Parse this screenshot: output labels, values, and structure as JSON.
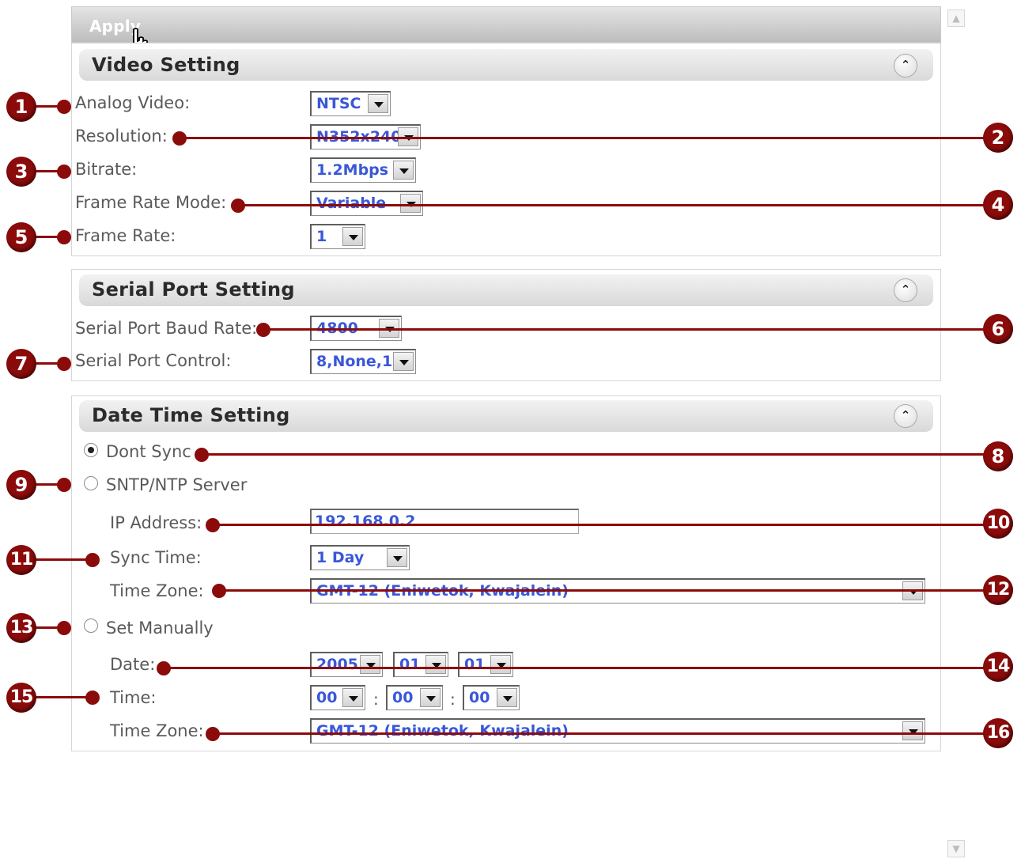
{
  "toolbar": {
    "apply_label": "Apply"
  },
  "video": {
    "title": "Video Setting",
    "analog_label": "Analog Video:",
    "analog_value": "NTSC",
    "resolution_label": "Resolution:",
    "resolution_value": "N352x240",
    "bitrate_label": "Bitrate:",
    "bitrate_value": "1.2Mbps",
    "framerate_mode_label": "Frame Rate Mode:",
    "framerate_mode_value": "Variable",
    "framerate_label": "Frame Rate:",
    "framerate_value": "1"
  },
  "serial": {
    "title": "Serial Port Setting",
    "baud_label": "Serial Port Baud Rate:",
    "baud_value": "4800",
    "control_label": "Serial Port Control:",
    "control_value": "8,None,1"
  },
  "datetime": {
    "title": "Date Time Setting",
    "dont_sync_label": "Dont Sync",
    "sntp_label": "SNTP/NTP Server",
    "ip_label": "IP Address:",
    "ip_value": "192.168.0.2",
    "sync_time_label": "Sync Time:",
    "sync_time_value": "1 Day",
    "tz_label": "Time Zone:",
    "tz_value": "GMT-12 (Eniwetok, Kwajalein)",
    "set_manually_label": "Set Manually",
    "date_label": "Date:",
    "year": "2005",
    "month": "01",
    "day": "01",
    "time_label": "Time:",
    "hour": "00",
    "minute": "00",
    "second": "00",
    "tz2_label": "Time Zone:",
    "tz2_value": "GMT-12 (Eniwetok, Kwajalein)",
    "time_separator": ":"
  },
  "annotations": [
    "1",
    "2",
    "3",
    "4",
    "5",
    "6",
    "7",
    "8",
    "9",
    "10",
    "11",
    "12",
    "13",
    "14",
    "15",
    "16"
  ],
  "icons": {
    "collapse": "double-chevron-up-icon",
    "cursor": "hand-pointer-icon"
  },
  "colors": {
    "annotation": "#8b0b0b",
    "value_text": "#3a57d8"
  }
}
